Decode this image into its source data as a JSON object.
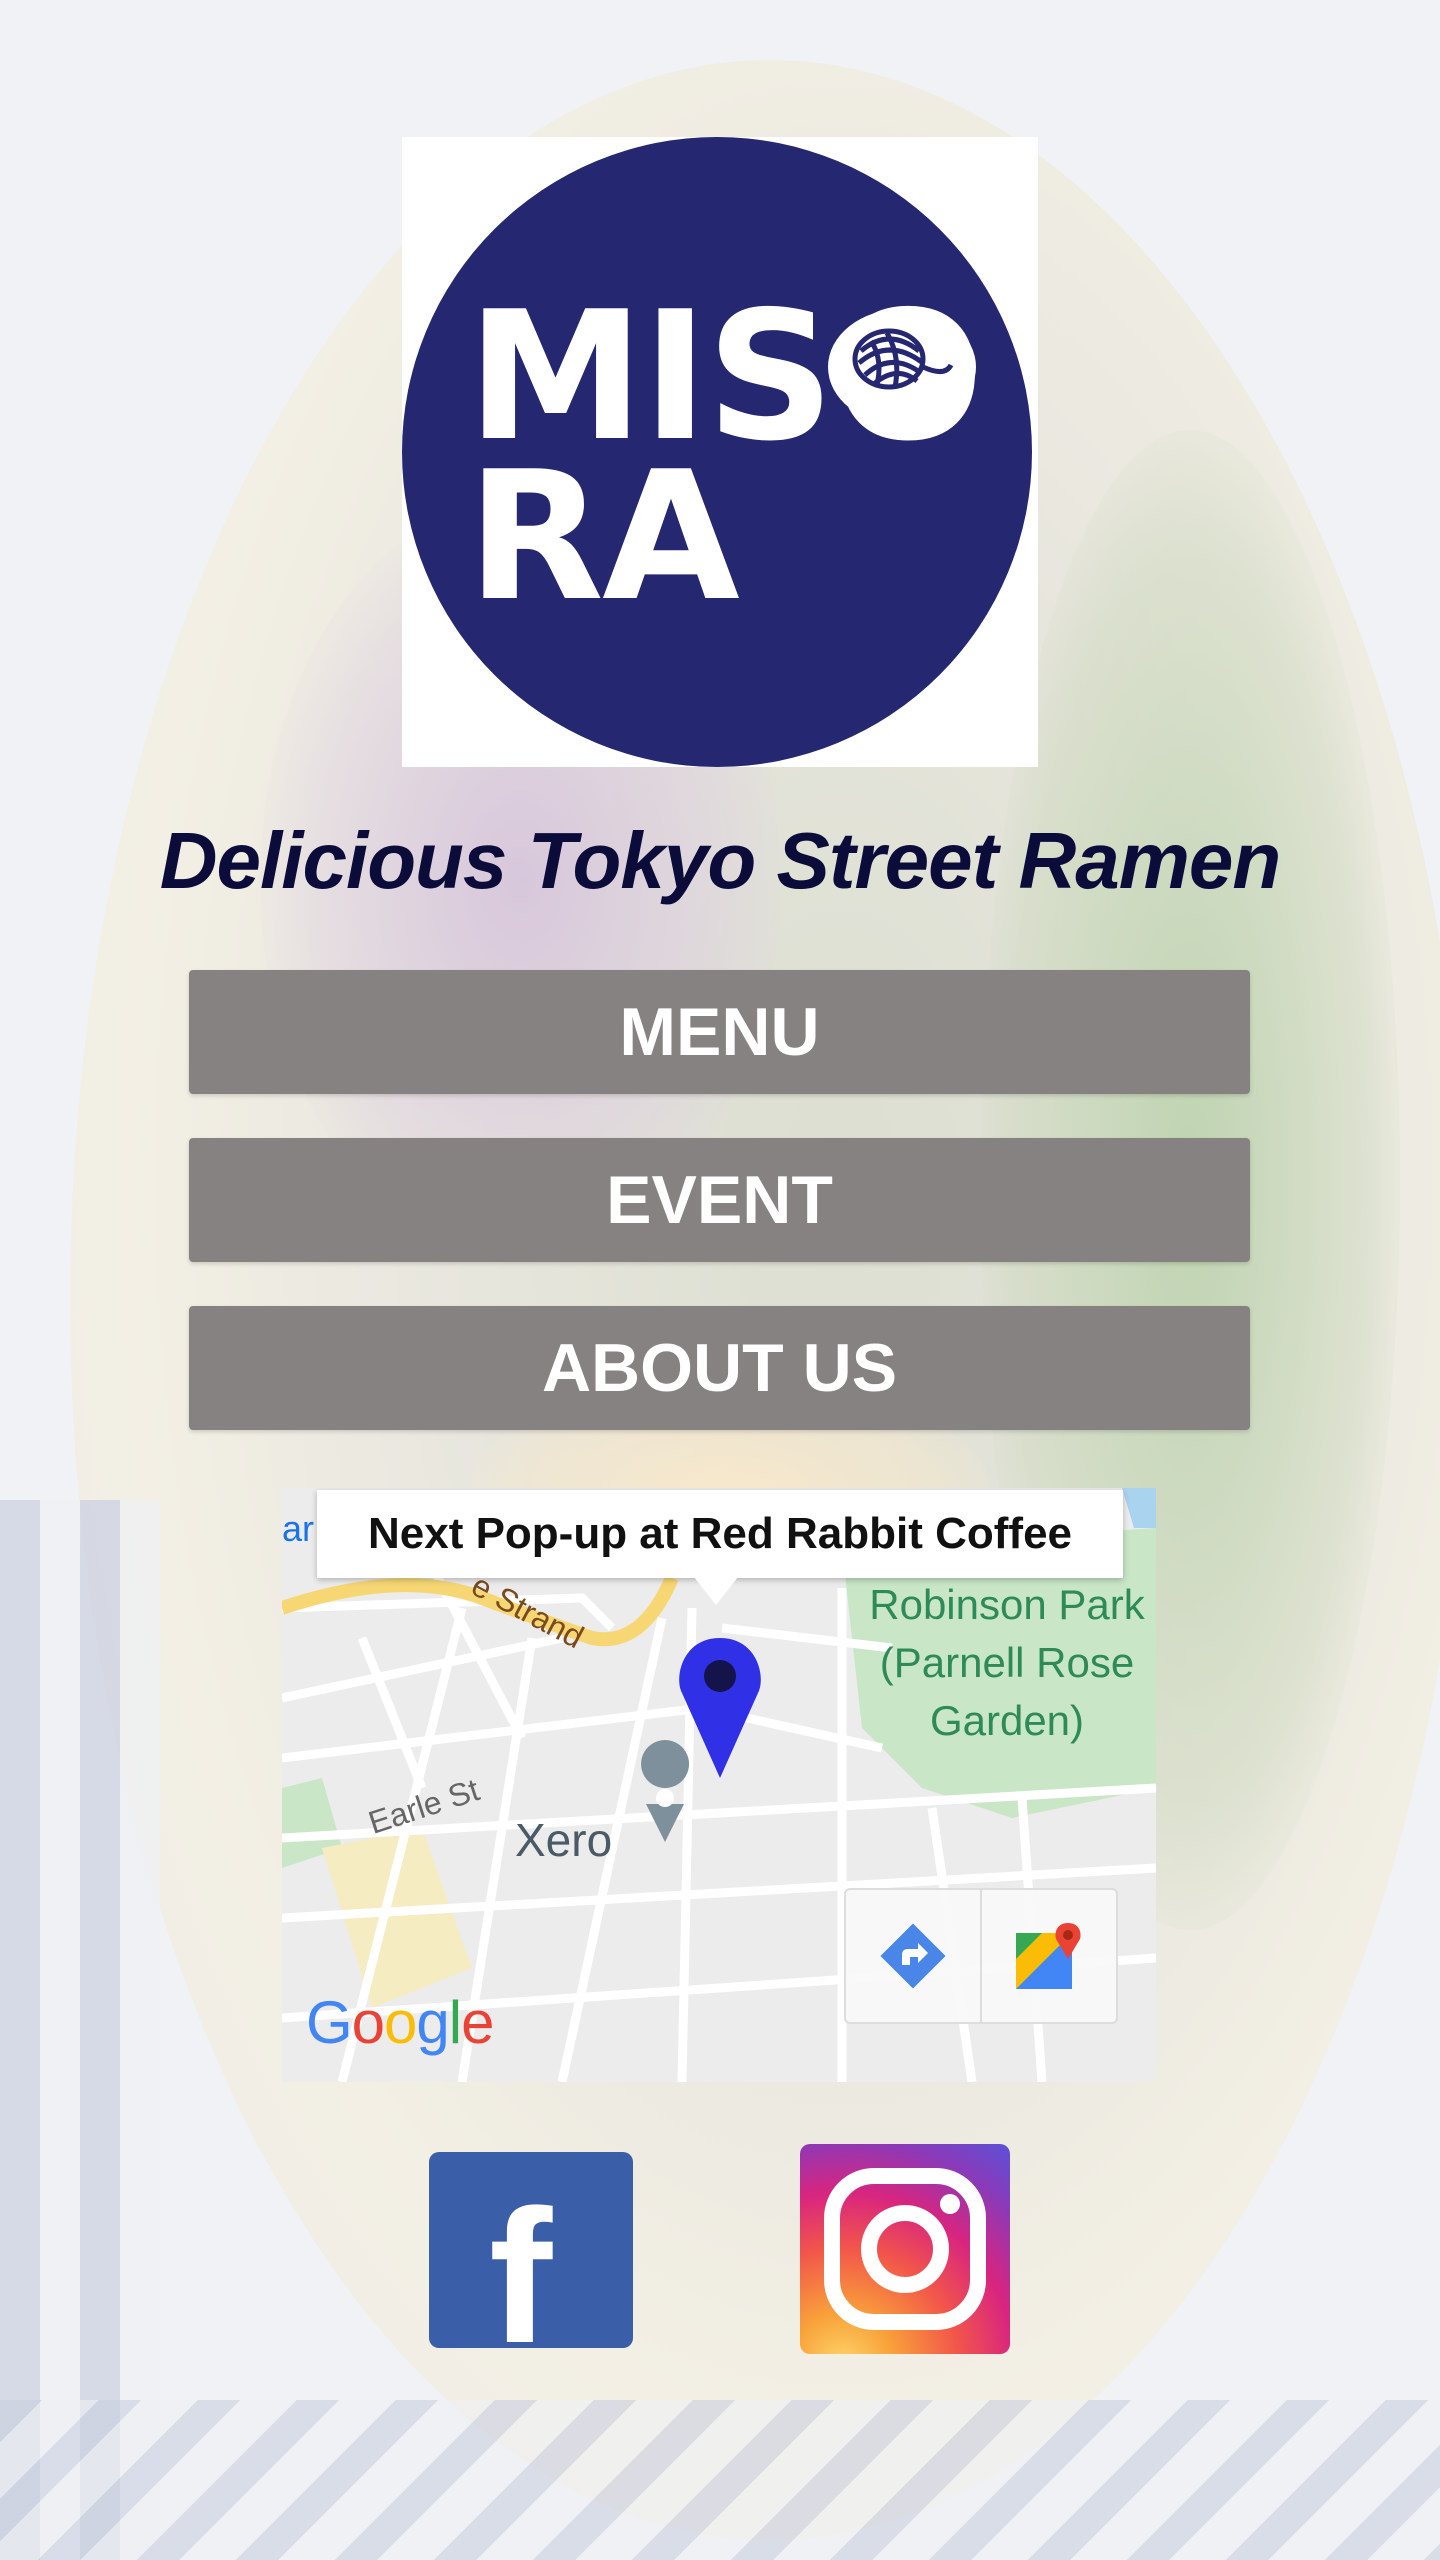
{
  "brand": {
    "logo_line1": "MISO",
    "logo_line2": "RA",
    "tagline": "Delicious Tokyo Street Ramen",
    "brand_color": "#252770"
  },
  "nav": {
    "menu_label": "MENU",
    "event_label": "EVENT",
    "about_label": "ABOUT US",
    "button_color": "#858281"
  },
  "map": {
    "info_window_text": "Next Pop-up at Red Rabbit Coffee",
    "park_label": "Robinson Park (Parnell Rose Garden)",
    "street_earle": "Earle St",
    "street_strand": "e Strand",
    "poi_xero": "Xero",
    "edge_label": "ar",
    "google_brand": "Google",
    "directions_icon": "directions-icon",
    "maps_icon": "google-maps-icon",
    "pin_color": "#3030e6"
  },
  "social": {
    "facebook_icon": "facebook-icon",
    "instagram_icon": "instagram-icon"
  }
}
